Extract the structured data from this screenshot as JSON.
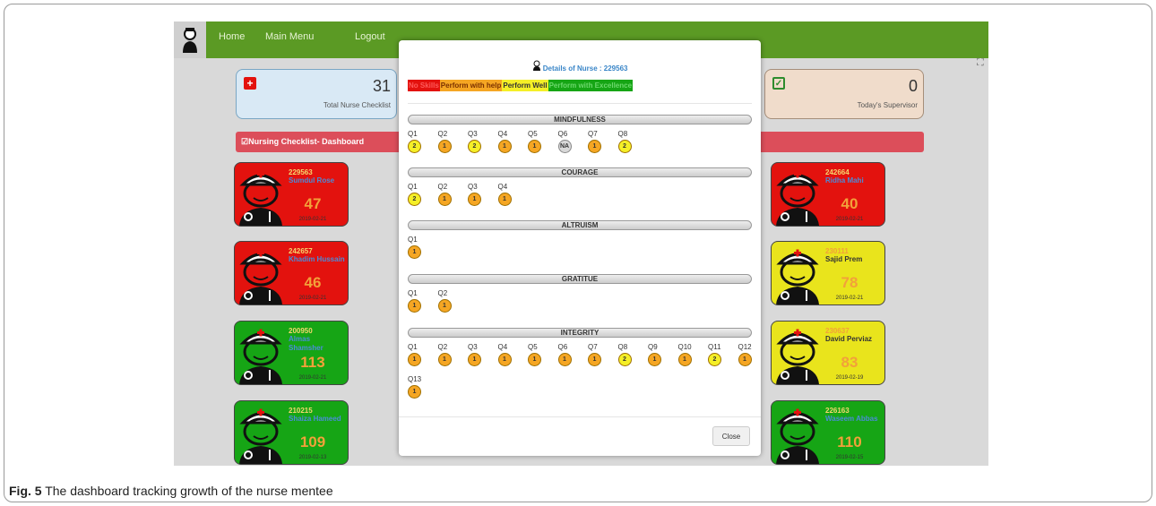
{
  "nav": {
    "home": "Home",
    "main_menu": "Main Menu",
    "logout": "Logout"
  },
  "stats": {
    "left": {
      "value": "31",
      "label": "Total Nurse Checklist",
      "icon": "plus-icon",
      "color": "#d9e9f5"
    },
    "right": {
      "value": "0",
      "label": "Today's Supervisor",
      "icon": "check-icon",
      "color": "#f0dccb"
    }
  },
  "dashboard_title": "Nursing Checklist- Dashboard",
  "cards_left": [
    {
      "id": "229563",
      "name": "Sumdul Rose",
      "score": "47",
      "date": "2019-02-21",
      "color": "red"
    },
    {
      "id": "242657",
      "name": "Khadim Hussain",
      "score": "46",
      "date": "2019-02-21",
      "color": "red"
    },
    {
      "id": "200950",
      "name": "Almas Shamsher",
      "score": "113",
      "date": "2019-02-21",
      "color": "green"
    },
    {
      "id": "210215",
      "name": "Shaiza Hameed",
      "score": "109",
      "date": "2019-02-13",
      "color": "green"
    }
  ],
  "cards_right": [
    {
      "id": "242664",
      "name": "Ridha Mahi",
      "score": "40",
      "date": "2019-02-21",
      "color": "red"
    },
    {
      "id": "230111",
      "name": "Sajid Prem",
      "score": "78",
      "date": "2019-02-21",
      "color": "yellow"
    },
    {
      "id": "230637",
      "name": "David Perviaz",
      "score": "83",
      "date": "2019-02-19",
      "color": "yellow"
    },
    {
      "id": "226163",
      "name": "Waseem Abbas",
      "score": "110",
      "date": "2019-02-15",
      "color": "green"
    }
  ],
  "modal": {
    "title": "Details of Nurse : 229563",
    "legend": [
      {
        "label": "No Skills",
        "bg": "#e3120e",
        "fg": "#ff5a5a"
      },
      {
        "label": "Perform with help",
        "bg": "#f5a623",
        "fg": "#7a3000"
      },
      {
        "label": "Perform Well",
        "bg": "#f5ef27",
        "fg": "#333"
      },
      {
        "label": "Perform with Excellence",
        "bg": "#16a515",
        "fg": "#6cd86c"
      }
    ],
    "sections": [
      {
        "title": "MINDFULNESS",
        "questions": [
          {
            "q": "Q1",
            "v": "2"
          },
          {
            "q": "Q2",
            "v": "1"
          },
          {
            "q": "Q3",
            "v": "2"
          },
          {
            "q": "Q4",
            "v": "1"
          },
          {
            "q": "Q5",
            "v": "1"
          },
          {
            "q": "Q6",
            "v": "NA"
          },
          {
            "q": "Q7",
            "v": "1"
          },
          {
            "q": "Q8",
            "v": "2"
          }
        ]
      },
      {
        "title": "COURAGE",
        "questions": [
          {
            "q": "Q1",
            "v": "2"
          },
          {
            "q": "Q2",
            "v": "1"
          },
          {
            "q": "Q3",
            "v": "1"
          },
          {
            "q": "Q4",
            "v": "1"
          }
        ]
      },
      {
        "title": "ALTRUISM",
        "questions": [
          {
            "q": "Q1",
            "v": "1"
          }
        ]
      },
      {
        "title": "GRATITUE",
        "questions": [
          {
            "q": "Q1",
            "v": "1"
          },
          {
            "q": "Q2",
            "v": "1"
          }
        ]
      },
      {
        "title": "INTEGRITY",
        "questions": [
          {
            "q": "Q1",
            "v": "1"
          },
          {
            "q": "Q2",
            "v": "1"
          },
          {
            "q": "Q3",
            "v": "1"
          },
          {
            "q": "Q4",
            "v": "1"
          },
          {
            "q": "Q5",
            "v": "1"
          },
          {
            "q": "Q6",
            "v": "1"
          },
          {
            "q": "Q7",
            "v": "1"
          },
          {
            "q": "Q8",
            "v": "2"
          },
          {
            "q": "Q9",
            "v": "1"
          },
          {
            "q": "Q10",
            "v": "1"
          },
          {
            "q": "Q11",
            "v": "2"
          },
          {
            "q": "Q12",
            "v": "1"
          },
          {
            "q": "Q13",
            "v": "1"
          }
        ]
      }
    ],
    "close_label": "Close"
  },
  "caption": {
    "label": "Fig. 5",
    "text": "The dashboard tracking growth of the nurse mentee"
  }
}
